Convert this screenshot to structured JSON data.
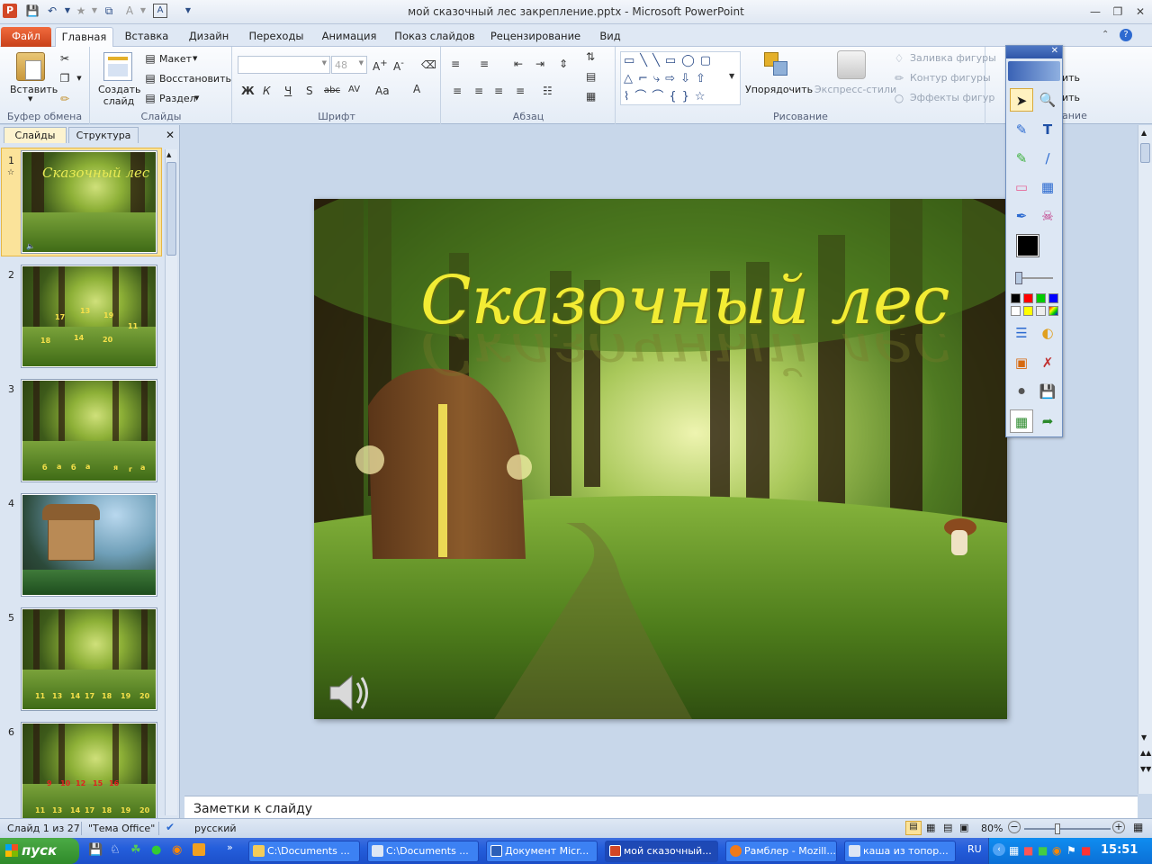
{
  "window": {
    "title": "мой сказочный лес  закрепление.pptx  -  Microsoft PowerPoint",
    "app_icon_letter": "P"
  },
  "ribbon_tabs": [
    "Файл",
    "Главная",
    "Вставка",
    "Дизайн",
    "Переходы",
    "Анимация",
    "Показ слайдов",
    "Рецензирование",
    "Вид"
  ],
  "clipboard": {
    "paste": "Вставить",
    "label": "Буфер обмена"
  },
  "slides_group": {
    "new_slide": "Создать слайд",
    "layout": "Макет",
    "reset": "Восстановить",
    "section": "Раздел",
    "label": "Слайды"
  },
  "font_group": {
    "font_size": "48",
    "label": "Шрифт"
  },
  "paragraph_group": {
    "label": "Абзац"
  },
  "drawing_group": {
    "arrange": "Упорядочить",
    "quick_styles": "Экспресс-стили",
    "shape_fill": "Заливка фигуры",
    "shape_outline": "Контур фигуры",
    "shape_effects": "Эффекты фигур",
    "label": "Рисование"
  },
  "editing_partial": {
    "find": "ить",
    "replace": "ить",
    "label": "ание"
  },
  "panel_tabs": {
    "slides": "Слайды",
    "outline": "Структура"
  },
  "thumbnails": [
    {
      "no": "1",
      "title": "Сказочный лес"
    },
    {
      "no": "2",
      "numbers": [
        "17",
        "13",
        "19",
        "11",
        "18",
        "14",
        "20"
      ]
    },
    {
      "no": "3",
      "letters": [
        "б",
        "а",
        "б",
        "а",
        "я",
        "г",
        "а"
      ]
    },
    {
      "no": "4"
    },
    {
      "no": "5",
      "numbers": [
        "11",
        "13",
        "14",
        "17",
        "18",
        "19",
        "20"
      ]
    },
    {
      "no": "6",
      "red": [
        "9",
        "10",
        "12",
        "15",
        "16"
      ],
      "numbers": [
        "11",
        "13",
        "14",
        "17",
        "18",
        "19",
        "20"
      ]
    }
  ],
  "slide": {
    "title": "Сказочный лес"
  },
  "notes": {
    "placeholder": "Заметки к слайду"
  },
  "status": {
    "slide_info": "Слайд 1 из 27",
    "theme": "\"Тема Office\"",
    "language": "русский",
    "zoom": "80%"
  },
  "taskbar": {
    "start": "пуск",
    "buttons": [
      "C:\\Documents ...",
      "C:\\Documents ...",
      "Документ Micr...",
      "мой сказочный...",
      "Рамблер - Mozill...",
      "каша из топор..."
    ],
    "lang": "RU",
    "clock": "15:51"
  }
}
